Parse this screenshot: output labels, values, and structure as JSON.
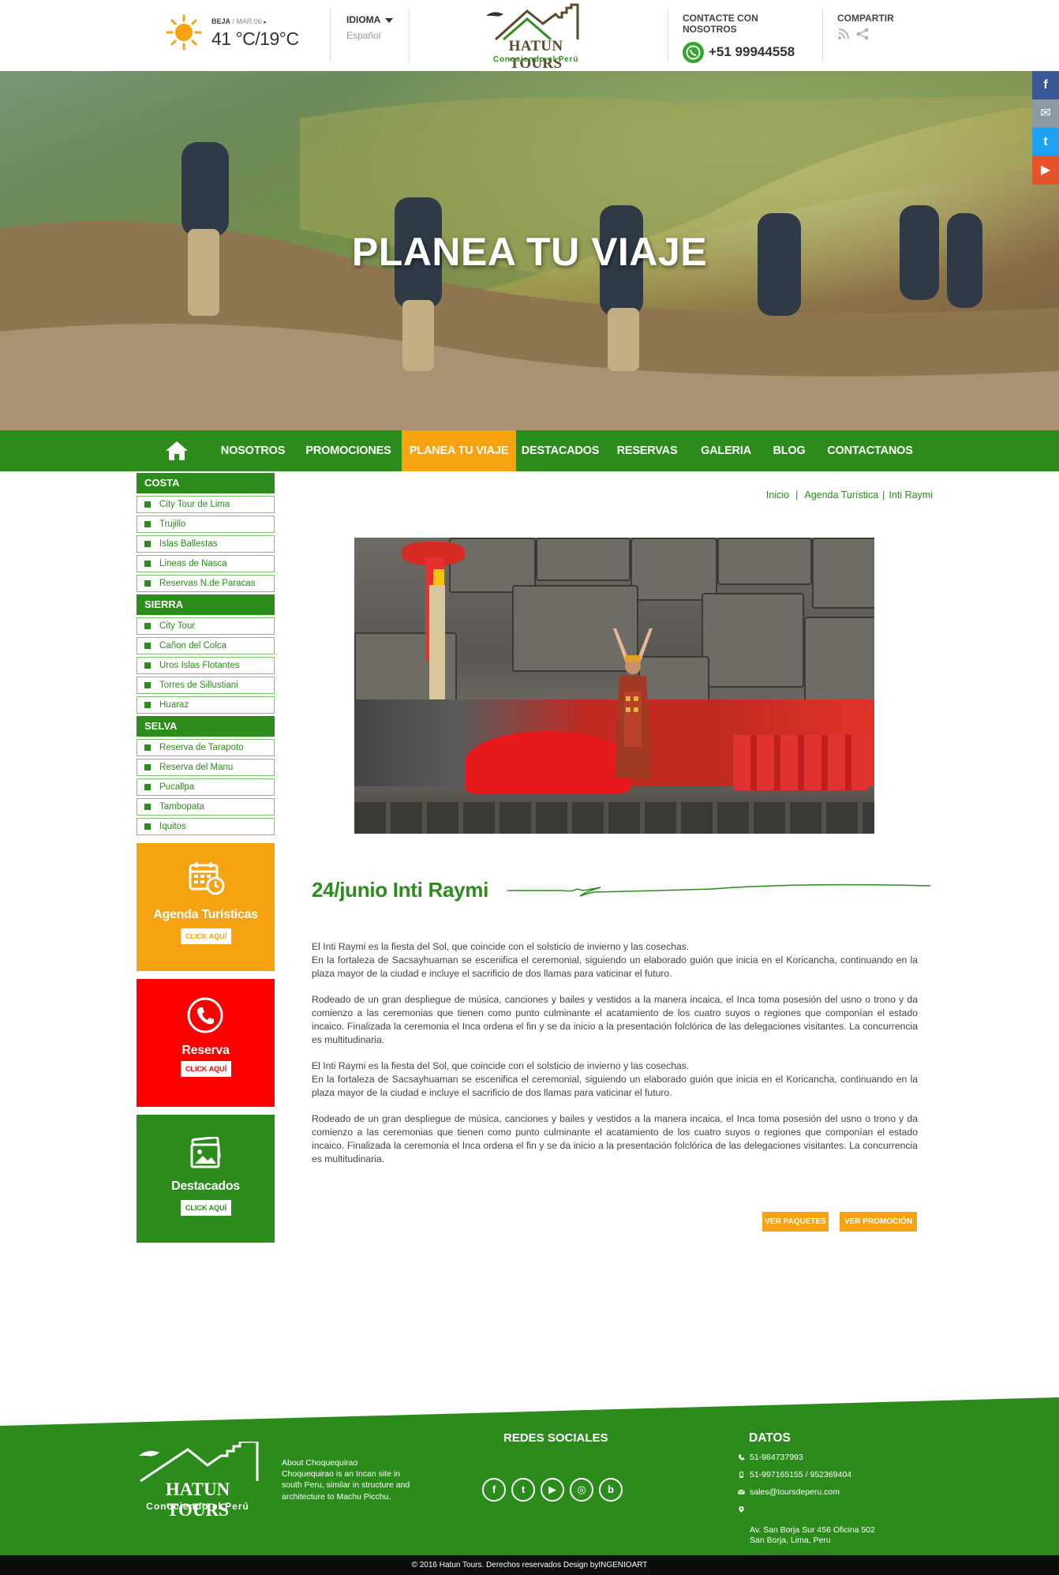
{
  "header": {
    "weather": {
      "city": "BEJA",
      "date": "/ MAR.06",
      "temperature": "41 °C/19°C"
    },
    "language": {
      "label": "IDIOMA",
      "value": "Español"
    },
    "logo": {
      "name": "HATUN TOURS",
      "tagline": "Conociendo el Perú"
    },
    "contact": {
      "label": "CONTACTE CON NOSOTROS",
      "phone": "+51 99944558"
    },
    "share": {
      "label": "COMPARTIR"
    }
  },
  "hero": {
    "title": "PLANEA TU VIAJE"
  },
  "side_social": [
    "f",
    "✉",
    "t",
    "▶"
  ],
  "nav": {
    "items": [
      "NOSOTROS",
      "PROMOCIONES",
      "PLANEA TU VIAJE",
      "DESTACADOS",
      "RESERVAS",
      "GALERIA",
      "BLOG",
      "CONTACTANOS"
    ],
    "active": "PLANEA TU VIAJE"
  },
  "sidebar": {
    "categories": [
      {
        "title": "COSTA",
        "items": [
          "City Tour de Lima",
          "Trujillo",
          "Islas Ballestas",
          "Lineas de Nasca",
          "Reservas N.de Paracas"
        ]
      },
      {
        "title": "SIERRA",
        "items": [
          "City Tour",
          "Cañon del Colca",
          "Uros Islas Flotantes",
          "Torres de Sillustiani",
          "Huaraz"
        ]
      },
      {
        "title": "SELVA",
        "items": [
          "Reserva de Tarapoto",
          "Reserva del Manu",
          "Pucallpa",
          "Tambopata",
          "Iquitos"
        ]
      }
    ],
    "promos": [
      {
        "title": "Agenda Turísticas",
        "button": "CLICK AQUÍ",
        "color": "#f7a311"
      },
      {
        "title": "Reserva",
        "button": "CLICK AQUÍ",
        "color": "#ff0000"
      },
      {
        "title": "Destacados",
        "button": "CLICK AQUÍ",
        "color": "#2b8c1c"
      }
    ]
  },
  "breadcrumb": [
    "Inicio",
    "Agenda Turística",
    "Inti Raymi"
  ],
  "article": {
    "title": "24/junio  Inti Raymi",
    "paragraphs": [
      "El Inti Raymi es la fiesta del Sol, que coincide con el solsticio de invierno y las cosechas.\nEn la fortaleza de Sacsayhuaman se escenifica el ceremonial, siguiendo un elaborado guión que inicia en el Koricancha, continuando en la plaza mayor de la ciudad e incluye el sacrificio de dos llamas para vaticinar el futuro.",
      "Rodeado de un gran despliegue de música, canciones y bailes y vestidos a la manera incaica, el Inca toma posesión del usno o trono y da comienzo a las ceremonias que tienen como punto culminante el acatamiento de los cuatro suyos o regiones que componían el estado incaico. Finalizada la ceremonia el Inca ordena el fin y se da inicio a la presentación folclórica de las delegaciones visitantes. La concurrencia es multitudinaria.",
      "El Inti Raymi es la fiesta del Sol, que coincide con el solsticio de invierno y las cosechas.\nEn la fortaleza de Sacsayhuaman se escenifica el ceremonial, siguiendo un elaborado guión que inicia en el Koricancha, continuando en la plaza mayor de la ciudad e incluye el sacrificio de dos llamas para vaticinar el futuro.",
      "Rodeado de un gran despliegue de música, canciones y bailes y vestidos a la manera incaica, el Inca toma posesión del usno o trono y da comienzo a las ceremonias que tienen como punto culminante el acatamiento de los cuatro suyos o regiones que componían el estado incaico. Finalizada la ceremonia el Inca ordena el fin y se da inicio a la presentación folclórica de las delegaciones visitantes. La concurrencia es multitudinaria."
    ],
    "buttons": {
      "packages": "VER PAQUETES",
      "promotion": "VER PROMOCIÓN"
    }
  },
  "footer": {
    "logo": {
      "name": "HATUN TOURS",
      "tagline": "Conociendo el Perú"
    },
    "about_title": "About Choquequirao",
    "about_text": "Choquequirao is an Incan site in south Peru, similar in structure and architecture to Machu Picchu.",
    "social_title": "REDES SOCIALES",
    "social_icons": [
      "f",
      "t",
      "▶",
      "◎",
      "b"
    ],
    "datos_title": "DATOS",
    "datos": {
      "phone": "51-984737993",
      "mobile": "51-997165155 / 952369404",
      "email": "sales@toursdeperu.com",
      "address": "Av. San Borja Sur 456 Oficina 502\nSan Borja, Lima, Peru"
    },
    "copyright": "© 2016  Hatun Tours. Derechos reservados Design byINGENIOART"
  }
}
